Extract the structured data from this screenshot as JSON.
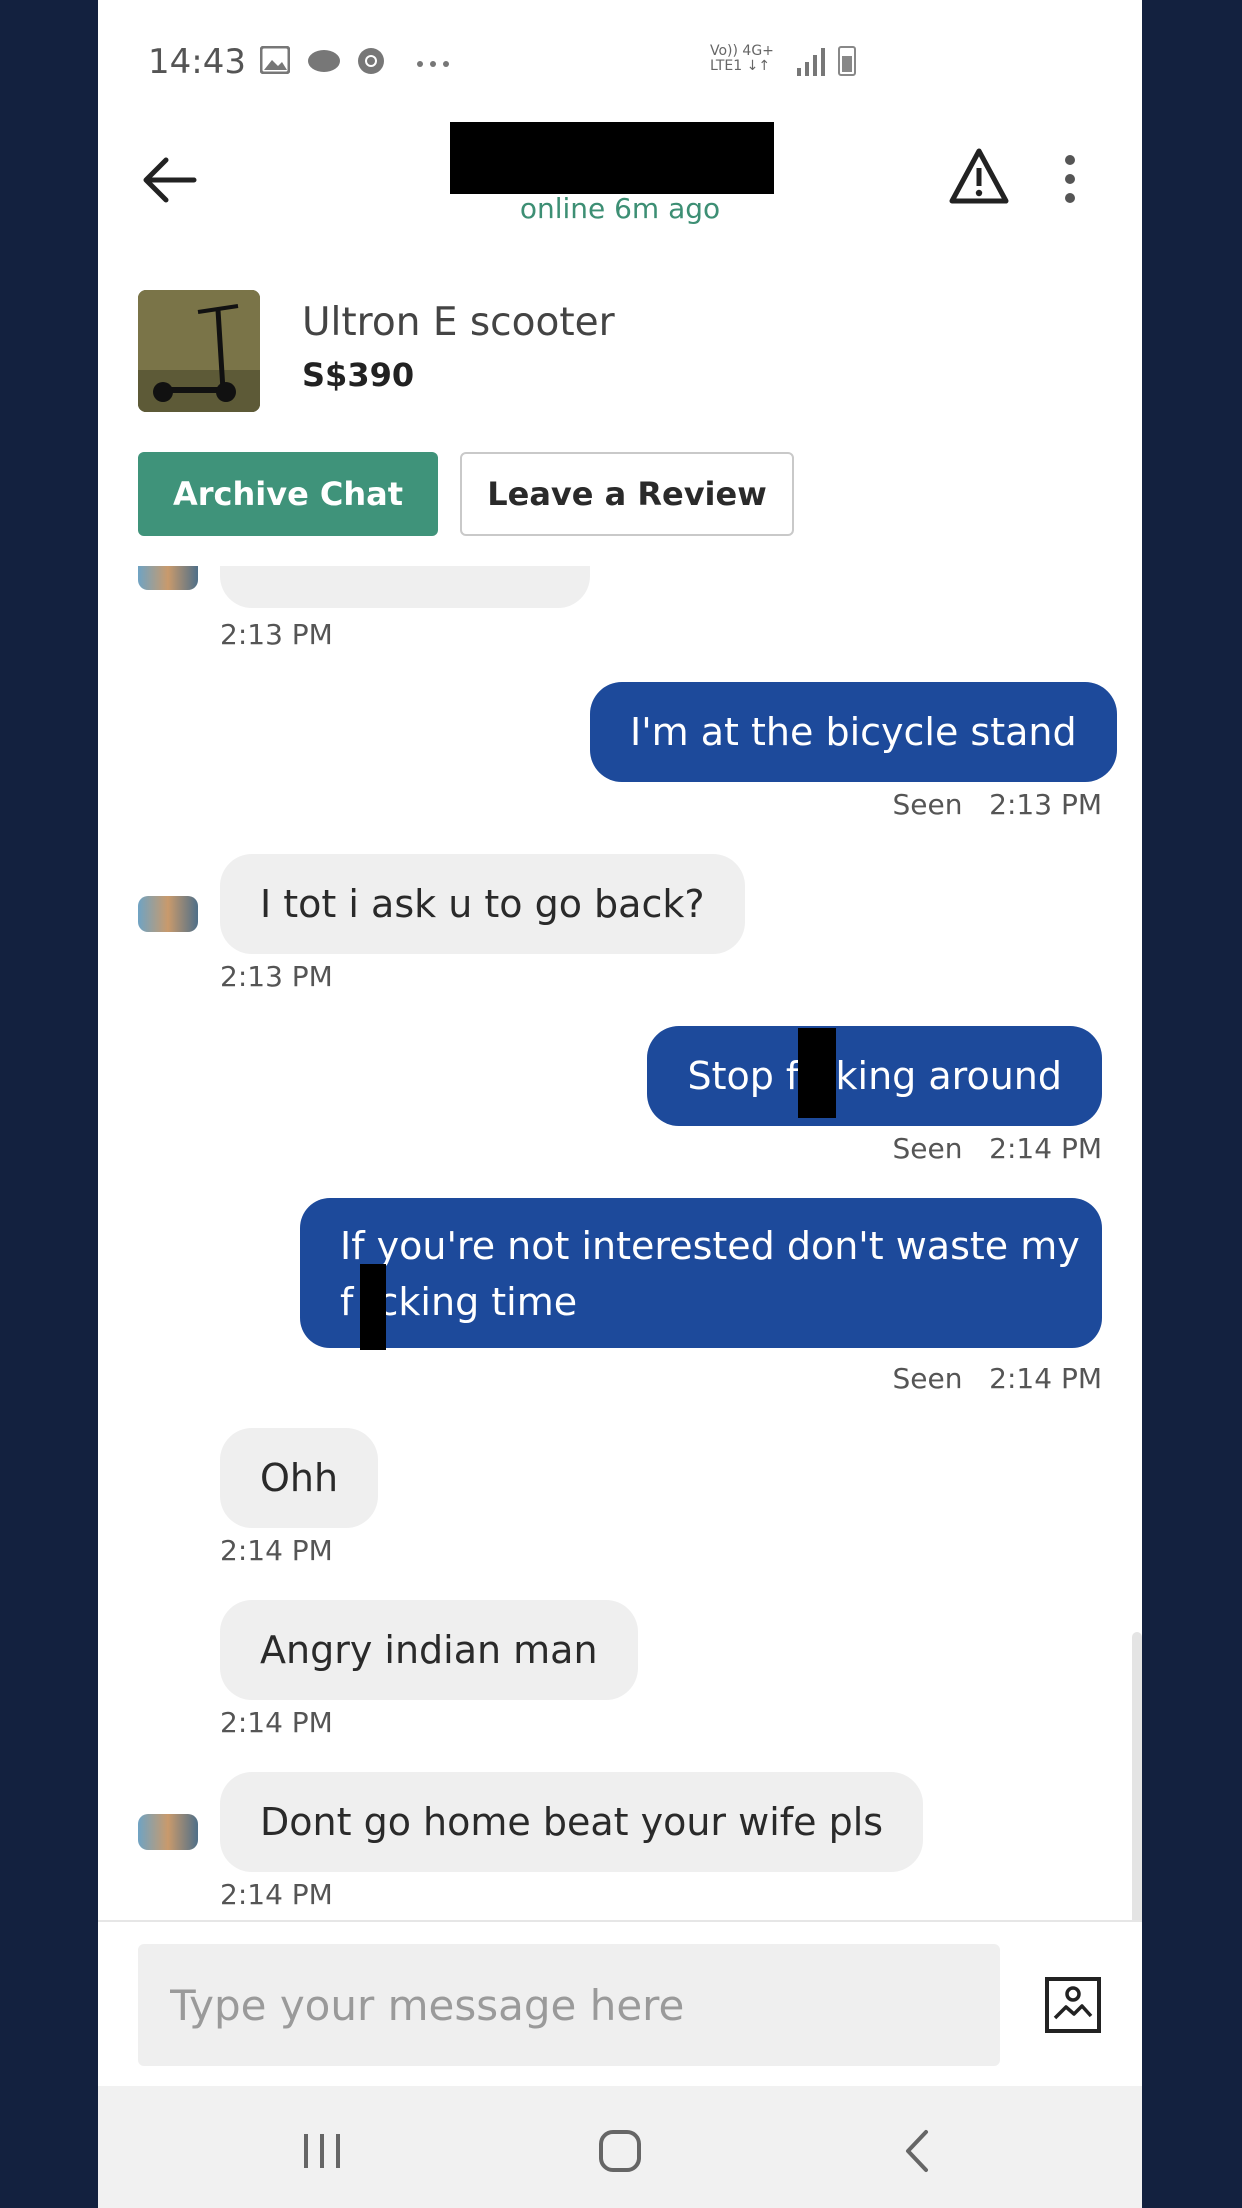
{
  "status_bar": {
    "time": "14:43",
    "net_top": "Vo))  4G+",
    "net_bottom": "LTE1  ↓↑"
  },
  "header": {
    "online_status": "online 6m ago"
  },
  "listing": {
    "title": "Ultron E scooter",
    "price": "S$390"
  },
  "actions": {
    "archive_label": "Archive Chat",
    "review_label": "Leave a Review"
  },
  "messages": [
    {
      "text": "",
      "time": "2:13 PM"
    },
    {
      "text": "I'm at the bicycle stand",
      "time": "2:13 PM",
      "seen": "Seen"
    },
    {
      "text": "I tot i ask u to go back?",
      "time": "2:13 PM"
    },
    {
      "text": "Stop f   king around",
      "time": "2:14 PM",
      "seen": "Seen"
    },
    {
      "line1": "If you're not interested don't waste my",
      "line2": "f  cking time",
      "time": "2:14 PM",
      "seen": "Seen"
    },
    {
      "text": "Ohh",
      "time": "2:14 PM"
    },
    {
      "text": "Angry indian man",
      "time": "2:14 PM"
    },
    {
      "text": "Dont go home beat your wife pls",
      "time": "2:14 PM"
    }
  ],
  "composer": {
    "placeholder": "Type your message here"
  },
  "icons": {
    "back": "back-arrow-icon",
    "report": "warning-icon",
    "more": "more-vertical-icon",
    "attach": "image-icon"
  },
  "colors": {
    "accent_green": "#3f937a",
    "outgoing_bubble": "#1d4a9b",
    "incoming_bubble": "#efefef",
    "background": "#13213f"
  }
}
